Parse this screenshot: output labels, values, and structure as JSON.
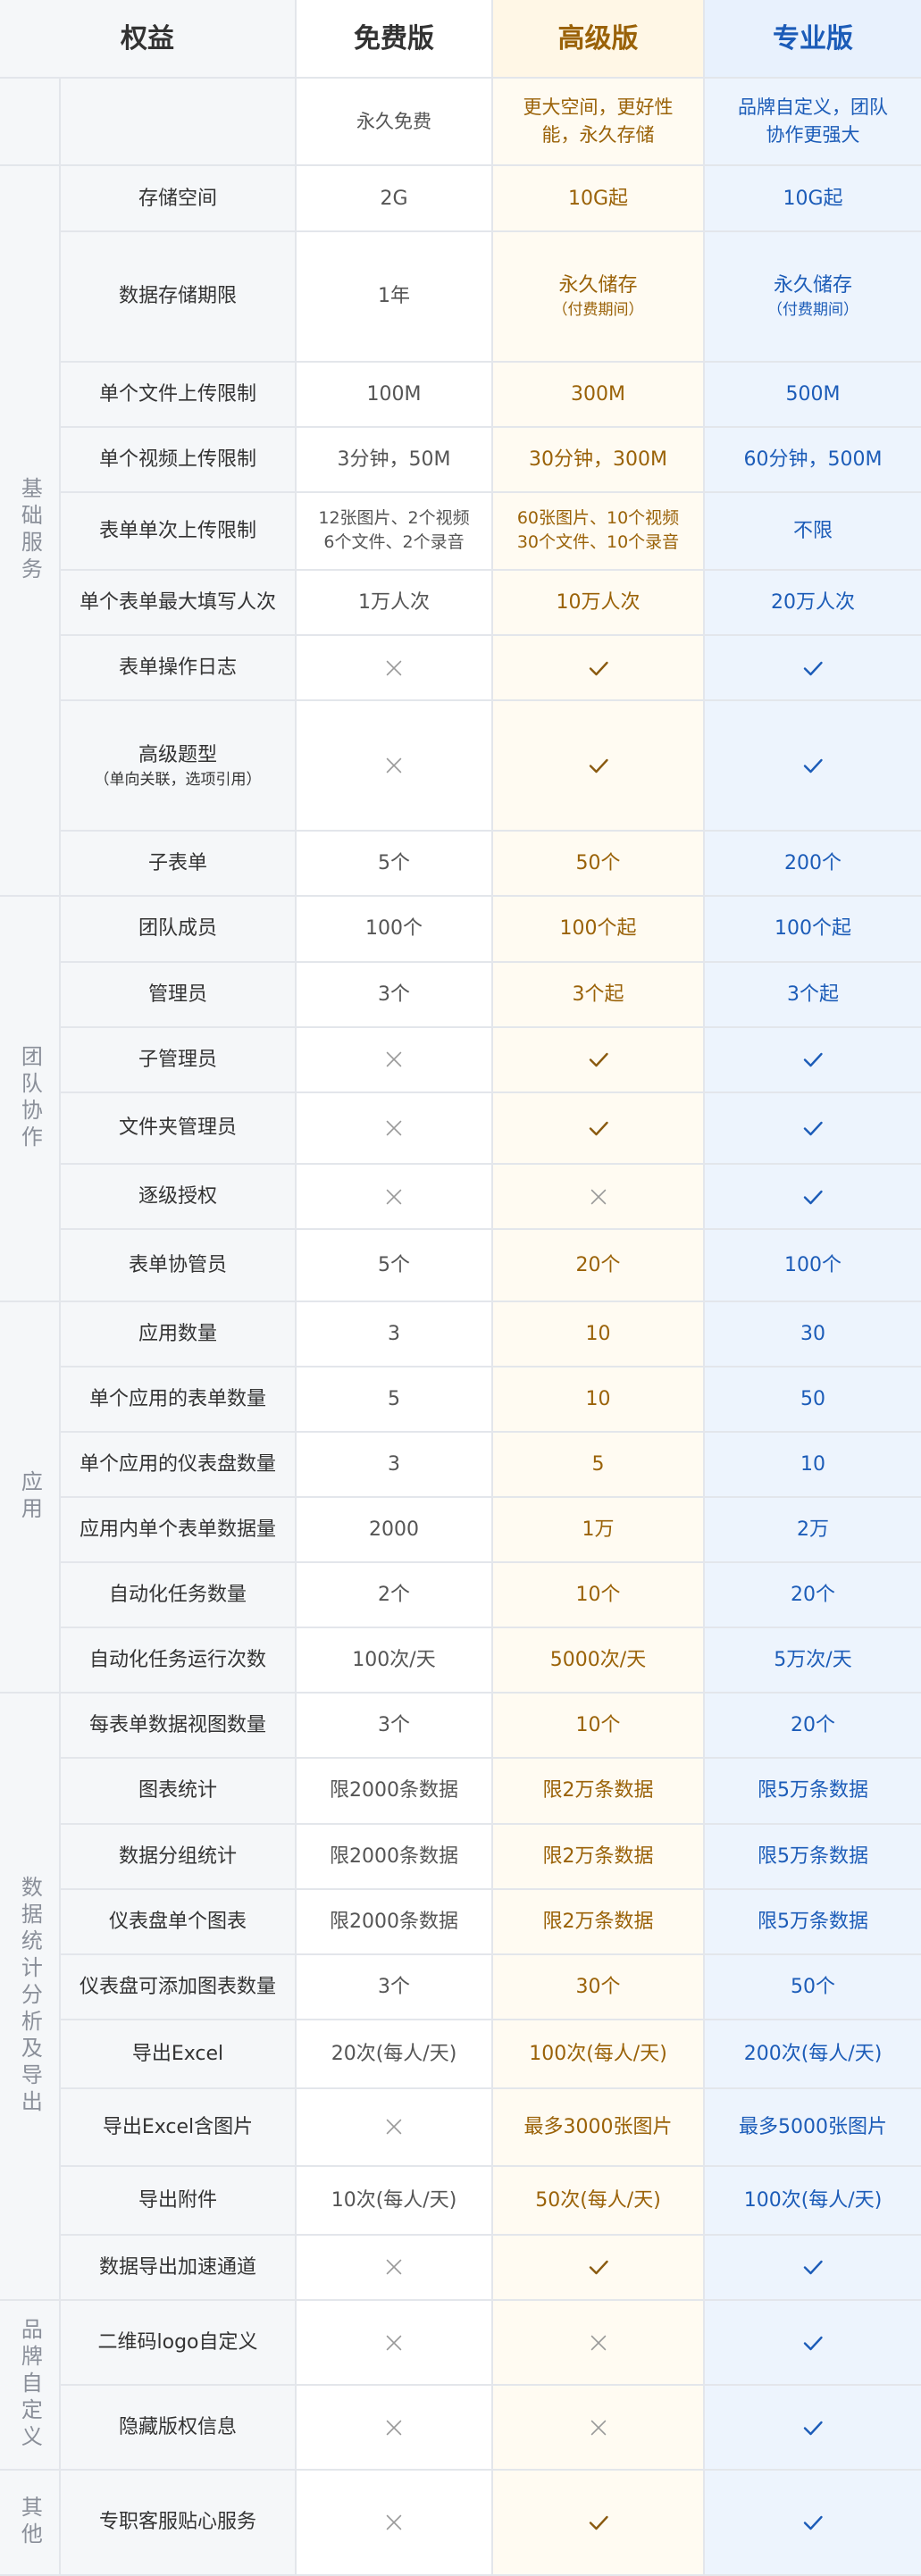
{
  "header": {
    "benefit": "权益",
    "free": "免费版",
    "advanced": "高级版",
    "pro": "专业版"
  },
  "desc": {
    "free": "永久免费",
    "advanced": "更大空间，更好性能，永久存储",
    "pro": "品牌自定义，团队协作更强大"
  },
  "colors": {
    "advanced_text": "#9a6208",
    "pro_text": "#1c5cb8",
    "cross": "#999999",
    "check_advanced": "#8a5a10",
    "check_pro": "#1c5cb8"
  },
  "icons": {
    "yes": "check-icon",
    "no": "cross-icon"
  },
  "sections": [
    {
      "name": "基础服务",
      "rows": [
        {
          "label": "存储空间",
          "free": "2G",
          "advanced": "10G起",
          "pro": "10G起"
        },
        {
          "label": "数据存储期限",
          "free": "1年",
          "advanced": "永久储存",
          "advanced_sub": "（付费期间）",
          "pro": "永久储存",
          "pro_sub": "（付费期间）",
          "h": 2
        },
        {
          "label": "单个文件上传限制",
          "free": "100M",
          "advanced": "300M",
          "pro": "500M"
        },
        {
          "label": "单个视频上传限制",
          "free": "3分钟，50M",
          "advanced": "30分钟，300M",
          "pro": "60分钟，500M"
        },
        {
          "label": "表单单次上传限制",
          "free": "12张图片、2个视频 6个文件、2个录音",
          "advanced": "60张图片、10个视频 30个文件、10个录音",
          "pro": "不限",
          "small": true,
          "h": 1.2
        },
        {
          "label": "单个表单最大填写人次",
          "free": "1万人次",
          "advanced": "10万人次",
          "pro": "20万人次"
        },
        {
          "label": "表单操作日志",
          "free": "no",
          "advanced": "yes",
          "pro": "yes"
        },
        {
          "label": "高级题型",
          "label_sub": "（单向关联，选项引用）",
          "free": "no",
          "advanced": "yes",
          "pro": "yes",
          "h": 2
        },
        {
          "label": "子表单",
          "free": "5个",
          "advanced": "50个",
          "pro": "200个"
        }
      ]
    },
    {
      "name": "团队协作",
      "rows": [
        {
          "label": "团队成员",
          "free": "100个",
          "advanced": "100个起",
          "pro": "100个起"
        },
        {
          "label": "管理员",
          "free": "3个",
          "advanced": "3个起",
          "pro": "3个起"
        },
        {
          "label": "子管理员",
          "free": "no",
          "advanced": "yes",
          "pro": "yes"
        },
        {
          "label": "文件夹管理员",
          "free": "no",
          "advanced": "yes",
          "pro": "yes",
          "h": 1.1
        },
        {
          "label": "逐级授权",
          "free": "no",
          "advanced": "no",
          "pro": "yes"
        },
        {
          "label": "表单协管员",
          "free": "5个",
          "advanced": "20个",
          "pro": "100个",
          "h": 1.1
        }
      ]
    },
    {
      "name": "应用",
      "rows": [
        {
          "label": "应用数量",
          "free": "3",
          "advanced": "10",
          "pro": "30"
        },
        {
          "label": "单个应用的表单数量",
          "free": "5",
          "advanced": "10",
          "pro": "50"
        },
        {
          "label": "单个应用的仪表盘数量",
          "free": "3",
          "advanced": "5",
          "pro": "10"
        },
        {
          "label": "应用内单个表单数据量",
          "free": "2000",
          "advanced": "1万",
          "pro": "2万"
        },
        {
          "label": "自动化任务数量",
          "free": "2个",
          "advanced": "10个",
          "pro": "20个"
        },
        {
          "label": "自动化任务运行次数",
          "free": "100次/天",
          "advanced": "5000次/天",
          "pro": "5万次/天"
        }
      ]
    },
    {
      "name": "数据统计分析及导出",
      "rows": [
        {
          "label": "每表单数据视图数量",
          "free": "3个",
          "advanced": "10个",
          "pro": "20个"
        },
        {
          "label": "图表统计",
          "free": "限2000条数据",
          "advanced": "限2万条数据",
          "pro": "限5万条数据"
        },
        {
          "label": "数据分组统计",
          "free": "限2000条数据",
          "advanced": "限2万条数据",
          "pro": "限5万条数据"
        },
        {
          "label": "仪表盘单个图表",
          "free": "限2000条数据",
          "advanced": "限2万条数据",
          "pro": "限5万条数据"
        },
        {
          "label": "仪表盘可添加图表数量",
          "free": "3个",
          "advanced": "30个",
          "pro": "50个"
        },
        {
          "label": "导出Excel",
          "free": "20次(每人/天)",
          "advanced": "100次(每人/天)",
          "pro": "200次(每人/天)",
          "h": 1.05
        },
        {
          "label": "导出Excel含图片",
          "free": "no",
          "advanced": "最多3000张图片",
          "pro": "最多5000张图片",
          "h": 1.2
        },
        {
          "label": "导出附件",
          "free": "10次(每人/天)",
          "advanced": "50次(每人/天)",
          "pro": "100次(每人/天)",
          "h": 1.05
        },
        {
          "label": "数据导出加速通道",
          "free": "no",
          "advanced": "yes",
          "pro": "yes"
        }
      ]
    },
    {
      "name": "品牌自定义",
      "rows": [
        {
          "label": "二维码logo自定义",
          "free": "no",
          "advanced": "no",
          "pro": "yes",
          "h": 1.3
        },
        {
          "label": "隐藏版权信息",
          "free": "no",
          "advanced": "no",
          "pro": "yes",
          "h": 1.3
        }
      ]
    },
    {
      "name": "其他",
      "rows": [
        {
          "label": "专职客服贴心服务",
          "free": "no",
          "advanced": "yes",
          "pro": "yes",
          "h": 1.6
        }
      ]
    }
  ]
}
